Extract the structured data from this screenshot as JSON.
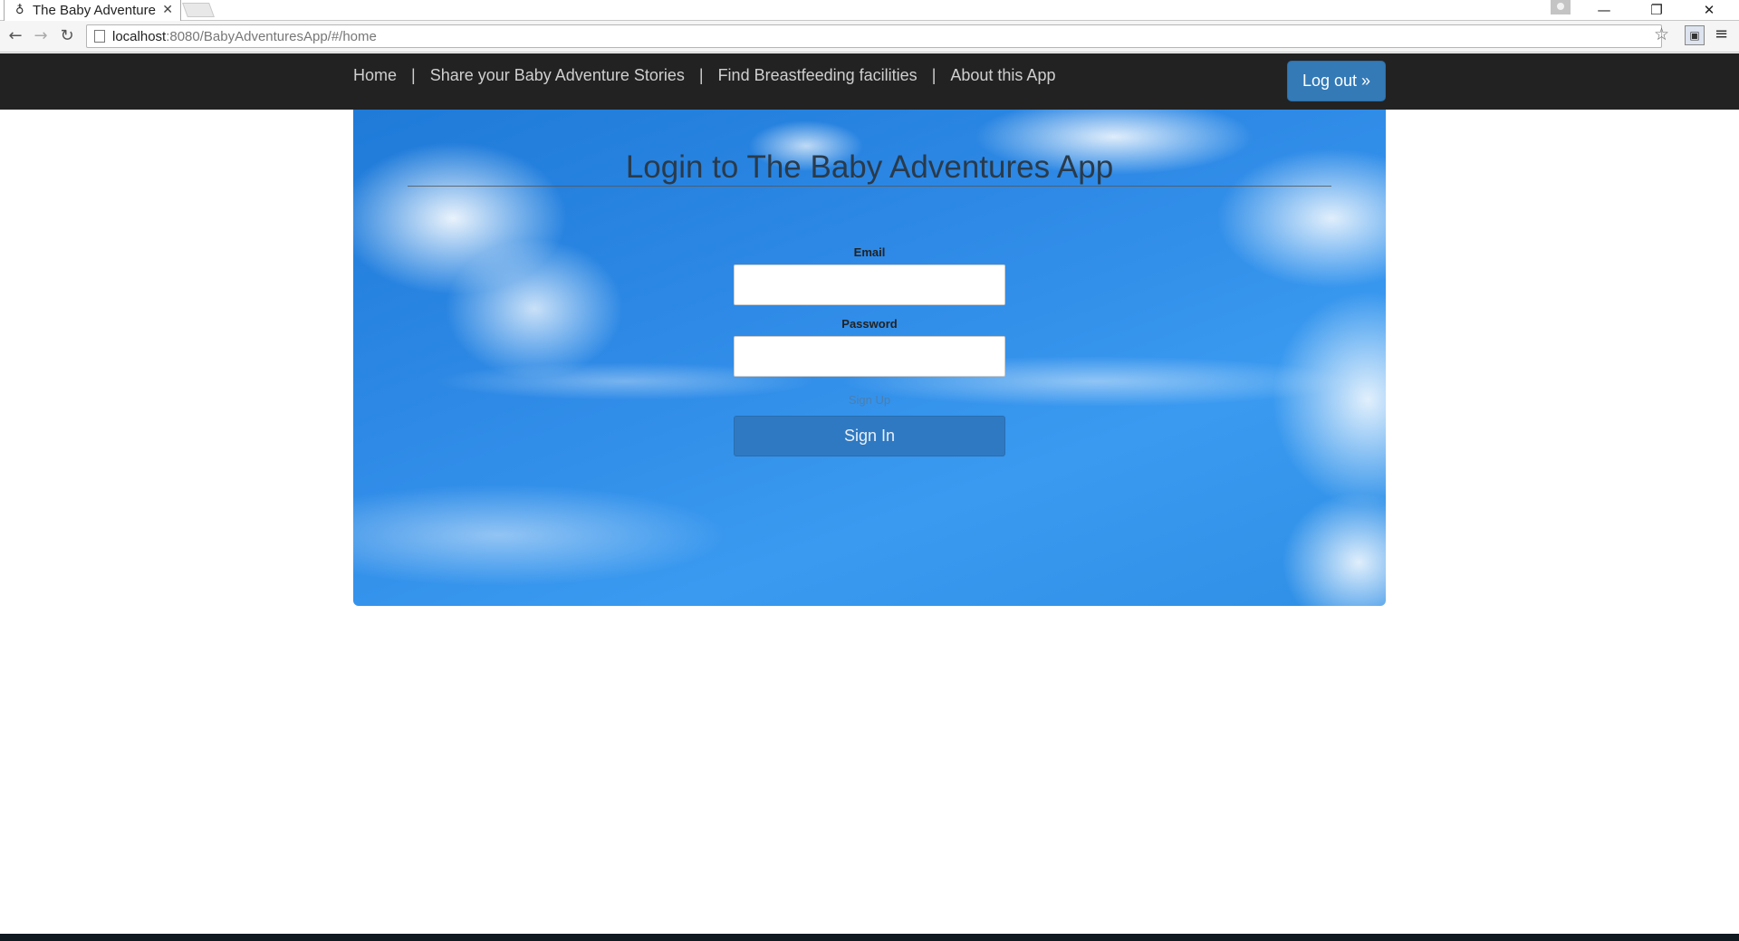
{
  "browser": {
    "tab_title": "The Baby Adventure",
    "tab_close": "✕",
    "url_host": "localhost",
    "url_path": ":8080/BabyAdventuresApp/#/home",
    "controls": {
      "minimize": "—",
      "restore": "❐",
      "close": "✕"
    }
  },
  "navbar": {
    "links": [
      "Home",
      "Share your Baby Adventure Stories",
      "Find Breastfeeding facilities",
      "About this App"
    ],
    "separator": "|",
    "logout_label": "Log out »",
    "background_color": "#222222",
    "button_color": "#337ab7"
  },
  "login": {
    "title": "Login to The Baby Adventures App",
    "email_label": "Email",
    "email_value": "",
    "password_label": "Password",
    "password_value": "",
    "signup_label": "Sign Up",
    "signin_label": "Sign In"
  },
  "icons": {
    "back": "back-arrow-icon",
    "forward": "forward-arrow-icon",
    "reload": "reload-icon",
    "page": "page-icon",
    "bookmark": "star-icon",
    "extension": "extension-icon",
    "menu": "hamburger-menu-icon"
  }
}
